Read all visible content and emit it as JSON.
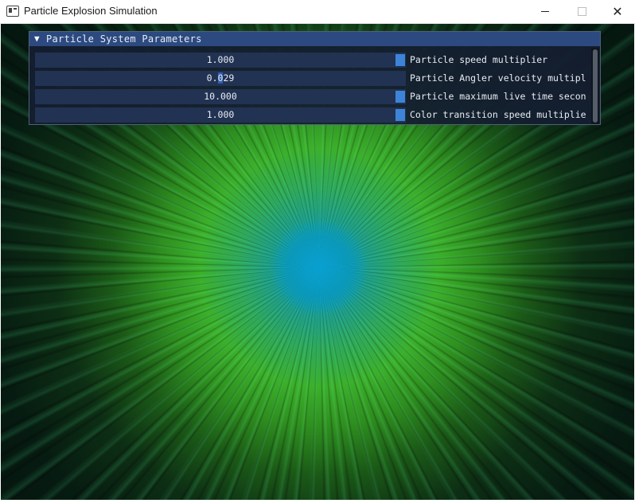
{
  "window": {
    "title": "Particle Explosion Simulation",
    "close_glyph": "✕"
  },
  "panel": {
    "title": "Particle System Parameters",
    "collapse_glyph": "▼",
    "params": [
      {
        "value": "1.000",
        "label": "Particle speed multiplier",
        "active": false
      },
      {
        "value_pre": "0.",
        "value_sel": "0",
        "value_post": "29",
        "label": "Particle Angler velocity multipl",
        "active": true
      },
      {
        "value": "10.000",
        "label": "Particle maximum live time secon",
        "active": false
      },
      {
        "value": "1.000",
        "label": "Color transition speed multiplie",
        "active": false
      }
    ]
  },
  "colors": {
    "header": "#2c4a80",
    "slider_bg": "#223252",
    "grab": "#3d84d8",
    "particle_core": "#0aa1c8",
    "particle_outer": "#3bb02b"
  }
}
